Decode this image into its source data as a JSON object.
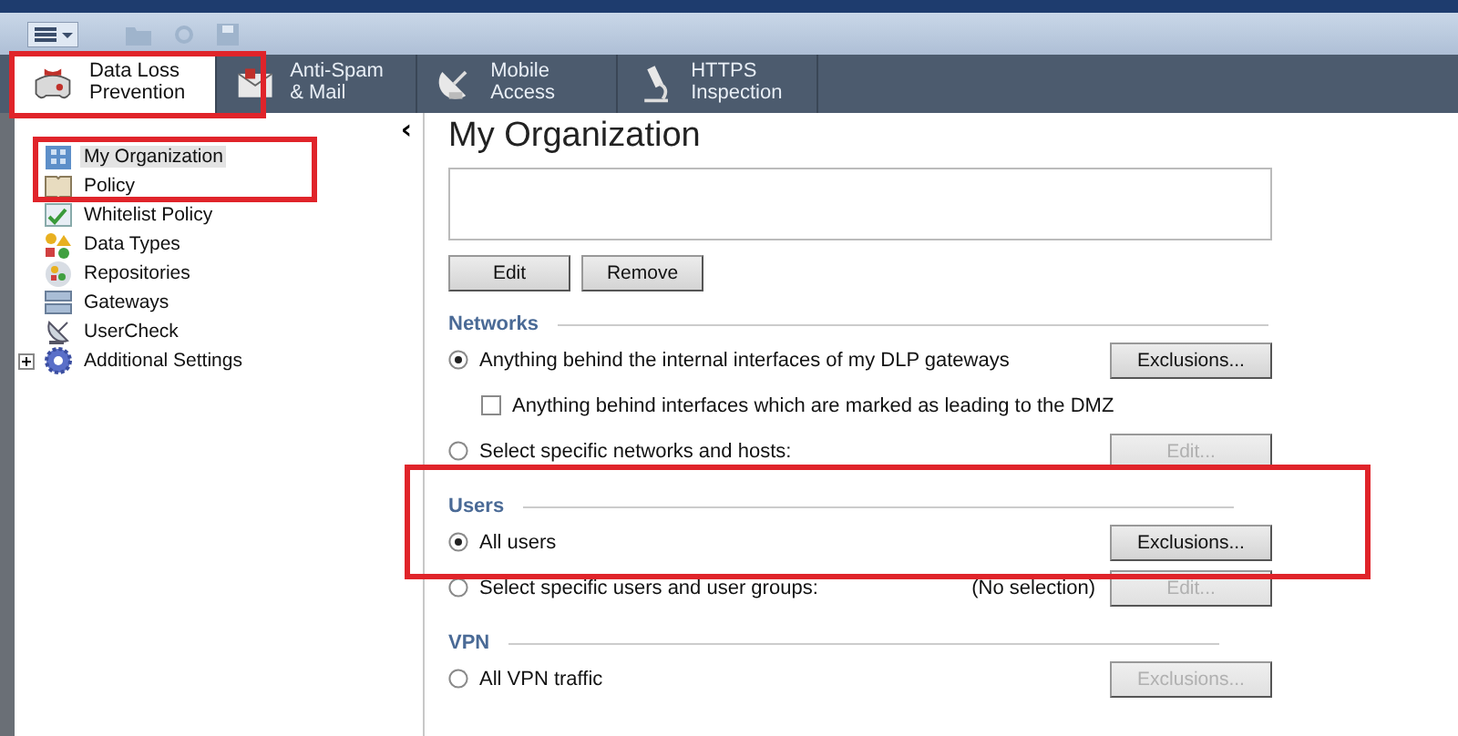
{
  "tabs": [
    {
      "label": "Data Loss Prevention",
      "selected": true
    },
    {
      "label": "Anti-Spam & Mail",
      "selected": false
    },
    {
      "label": "Mobile Access",
      "selected": false
    },
    {
      "label": "HTTPS Inspection",
      "selected": false
    }
  ],
  "sidebar": {
    "collapse_glyph": "‹",
    "items": [
      {
        "label": "My Organization",
        "selected": true
      },
      {
        "label": "Policy",
        "selected": false
      },
      {
        "label": "Whitelist Policy",
        "selected": false
      },
      {
        "label": "Data Types",
        "selected": false
      },
      {
        "label": "Repositories",
        "selected": false
      },
      {
        "label": "Gateways",
        "selected": false
      },
      {
        "label": "UserCheck",
        "selected": false
      },
      {
        "label": "Additional Settings",
        "selected": false,
        "expanded": false
      }
    ]
  },
  "page": {
    "title": "My Organization",
    "buttons": [
      "Edit",
      "Remove"
    ],
    "sections": [
      {
        "heading": "Networks",
        "options": [
          {
            "kind": "radio",
            "label": "Anything behind the internal interfaces of my DLP gateways",
            "selected": true,
            "button": {
              "label": "Exclusions...",
              "disabled": false
            }
          },
          {
            "kind": "checkbox",
            "label": "Anything behind interfaces which are marked as leading to the DMZ",
            "checked": false
          },
          {
            "kind": "radio",
            "label": "Select specific networks and hosts:",
            "selected": false,
            "button": {
              "label": "Edit...",
              "disabled": true
            }
          }
        ]
      },
      {
        "heading": "Users",
        "options": [
          {
            "kind": "radio",
            "label": "All users",
            "selected": true,
            "button": {
              "label": "Exclusions...",
              "disabled": false
            }
          },
          {
            "kind": "radio",
            "label": "Select specific users and user groups:",
            "selected": false,
            "note": "(No selection)",
            "button": {
              "label": "Edit...",
              "disabled": true
            }
          }
        ]
      },
      {
        "heading": "VPN",
        "options": [
          {
            "kind": "radio",
            "label": "All VPN traffic",
            "selected": false,
            "button": {
              "label": "Exclusions...",
              "disabled": true
            }
          }
        ]
      }
    ]
  }
}
